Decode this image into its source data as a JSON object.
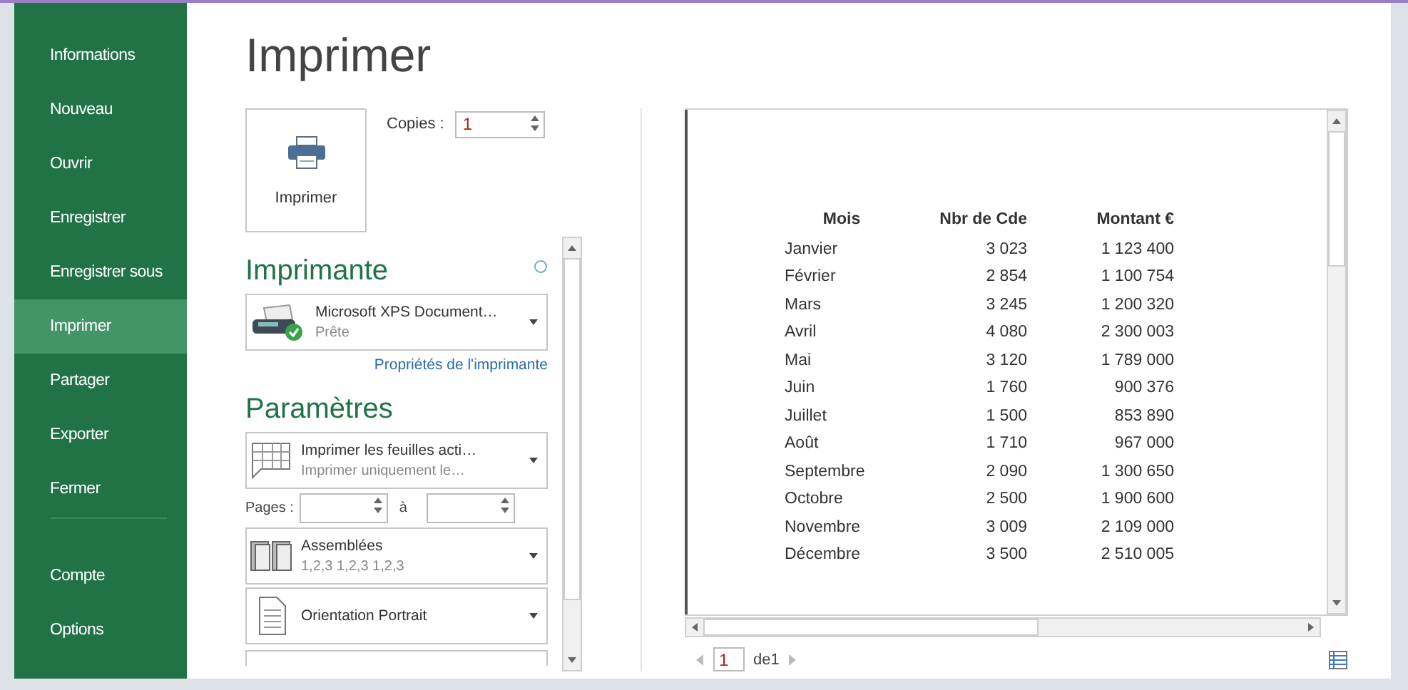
{
  "sidebar": {
    "items": [
      {
        "label": "Informations",
        "selected": false
      },
      {
        "label": "Nouveau",
        "selected": false
      },
      {
        "label": "Ouvrir",
        "selected": false
      },
      {
        "label": "Enregistrer",
        "selected": false
      },
      {
        "label": "Enregistrer sous",
        "selected": false
      },
      {
        "label": "Imprimer",
        "selected": true
      },
      {
        "label": "Partager",
        "selected": false
      },
      {
        "label": "Exporter",
        "selected": false
      },
      {
        "label": "Fermer",
        "selected": false
      }
    ],
    "bottom_items": [
      {
        "label": "Compte",
        "selected": false
      },
      {
        "label": "Options",
        "selected": false
      }
    ]
  },
  "title": "Imprimer",
  "print_button": {
    "label": "Imprimer"
  },
  "copies": {
    "label": "Copies :",
    "value": "1"
  },
  "printer": {
    "heading": "Imprimante",
    "name": "Microsoft XPS Document…",
    "status": "Prête",
    "properties_link": "Propriétés de l'imprimante"
  },
  "settings": {
    "heading": "Paramètres",
    "options": [
      {
        "kind": "sheets",
        "title": "Imprimer les feuilles acti…",
        "subtitle": "Imprimer uniquement le…"
      },
      {
        "kind": "pages",
        "label": "Pages :",
        "to_label": "à"
      },
      {
        "kind": "collate",
        "title": "Assemblées",
        "subtitle": "1,2,3   1,2,3   1,2,3"
      },
      {
        "kind": "orientation",
        "title": "Orientation Portrait"
      }
    ]
  },
  "preview": {
    "columns": [
      "Mois",
      "Nbr de Cde",
      "Montant €"
    ],
    "rows": [
      [
        "Janvier",
        "3 023",
        "1 123 400"
      ],
      [
        "Février",
        "2 854",
        "1 100 754"
      ],
      [
        "Mars",
        "3 245",
        "1 200 320"
      ],
      [
        "Avril",
        "4 080",
        "2 300 003"
      ],
      [
        "Mai",
        "3 120",
        "1 789 000"
      ],
      [
        "Juin",
        "1 760",
        "900 376"
      ],
      [
        "Juillet",
        "1 500",
        "853 890"
      ],
      [
        "Août",
        "1 710",
        "967 000"
      ],
      [
        "Septembre",
        "2 090",
        "1 300 650"
      ],
      [
        "Octobre",
        "2 500",
        "1 900 600"
      ],
      [
        "Novembre",
        "3 009",
        "2 109 000"
      ],
      [
        "Décembre",
        "3 500",
        "2 510 005"
      ]
    ]
  },
  "pager": {
    "page": "1",
    "of": "de1"
  }
}
